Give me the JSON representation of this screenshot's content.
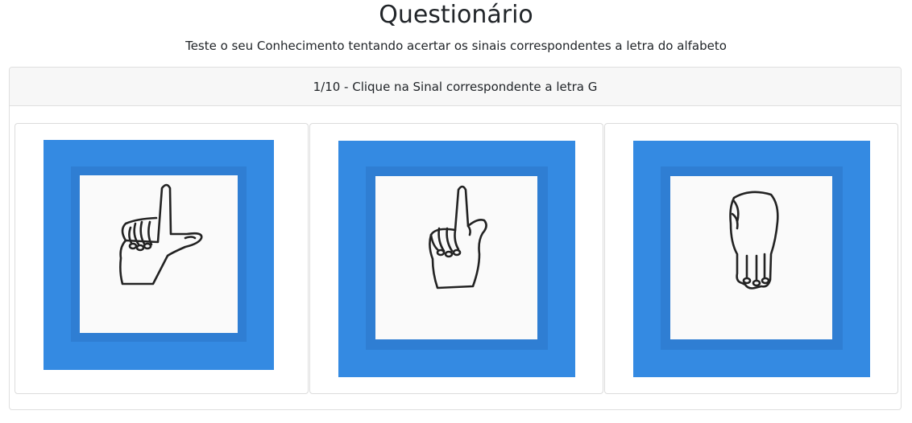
{
  "page": {
    "title": "Questionário",
    "subtitle": "Teste o seu Conhecimento tentando acertar os sinais correspondentes a letra do alfabeto"
  },
  "question": {
    "header": "1/10 - Clique na Sinal correspondente a letra G"
  },
  "options": [
    {
      "icon": "hand-sign-l-icon"
    },
    {
      "icon": "hand-sign-d-icon"
    },
    {
      "icon": "hand-sign-m-icon"
    }
  ],
  "colors": {
    "frame_blue": "#348ae2",
    "inner_blue": "#2f7ed3",
    "header_bg": "#f7f7f7"
  }
}
